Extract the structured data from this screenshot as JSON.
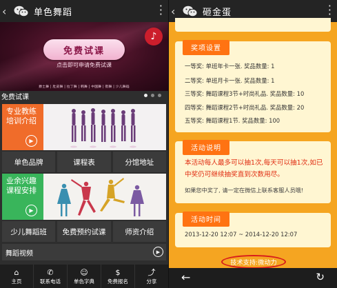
{
  "left": {
    "topbar": {
      "back": "‹",
      "title": "单色舞蹈"
    },
    "banner": {
      "trial_button": "免费试课",
      "hint": "点击即可申请免费试课",
      "dance_types": "爵士舞 | 肚皮舞 | 拉丁舞 | 韩舞 | 中国舞 | 街舞 | 少儿舞蹈",
      "music_icon": "♪"
    },
    "section_label": "免费试课",
    "features": [
      {
        "label": "专业教练培训介绍",
        "color": "#f06c2a"
      },
      {
        "label": "业余兴趣课程安排",
        "color": "#39b55b"
      }
    ],
    "row1": [
      "单色品牌",
      "课程表",
      "分馆地址"
    ],
    "row2": [
      "少儿舞蹈班",
      "免费预约试课",
      "师资介绍"
    ],
    "video": "舞蹈视频",
    "nav": [
      {
        "icon": "⌂",
        "label": "主页"
      },
      {
        "icon": "✆",
        "label": "联系电话"
      },
      {
        "icon": "☺",
        "label": "单色字典"
      },
      {
        "icon": "$",
        "label": "免费报名"
      },
      {
        "icon": "⤴",
        "label": "分享"
      }
    ]
  },
  "right": {
    "topbar": {
      "back": "‹",
      "title": "砸金蛋"
    },
    "prizes": {
      "header": "奖项设置",
      "items": [
        "一等奖: 单班年卡一张. 奖品数量: 1",
        "二等奖: 单班月卡一张. 奖品数量: 1",
        "三等奖: 舞蹈课程3节+时尚礼品. 奖品数量: 10",
        "四等奖: 舞蹈课程2节+时尚礼品. 奖品数量: 20",
        "五等奖: 舞蹈课程1节. 奖品数量: 100"
      ]
    },
    "rules": {
      "header": "活动说明",
      "text": "本活动每人最多可以抽1次,每天可以抽1次,如已中奖仍可继续抽奖直到次数用尽。",
      "note": "如果您中奖了, 请一定在微信上联系客服人员哦!"
    },
    "period": {
      "header": "活动时间",
      "value": "2013-12-20 12:07 ~ 2014-12-20 12:07"
    },
    "support": "技术支持:微动力",
    "nav": {
      "back": "←",
      "refresh": "↻"
    }
  }
}
